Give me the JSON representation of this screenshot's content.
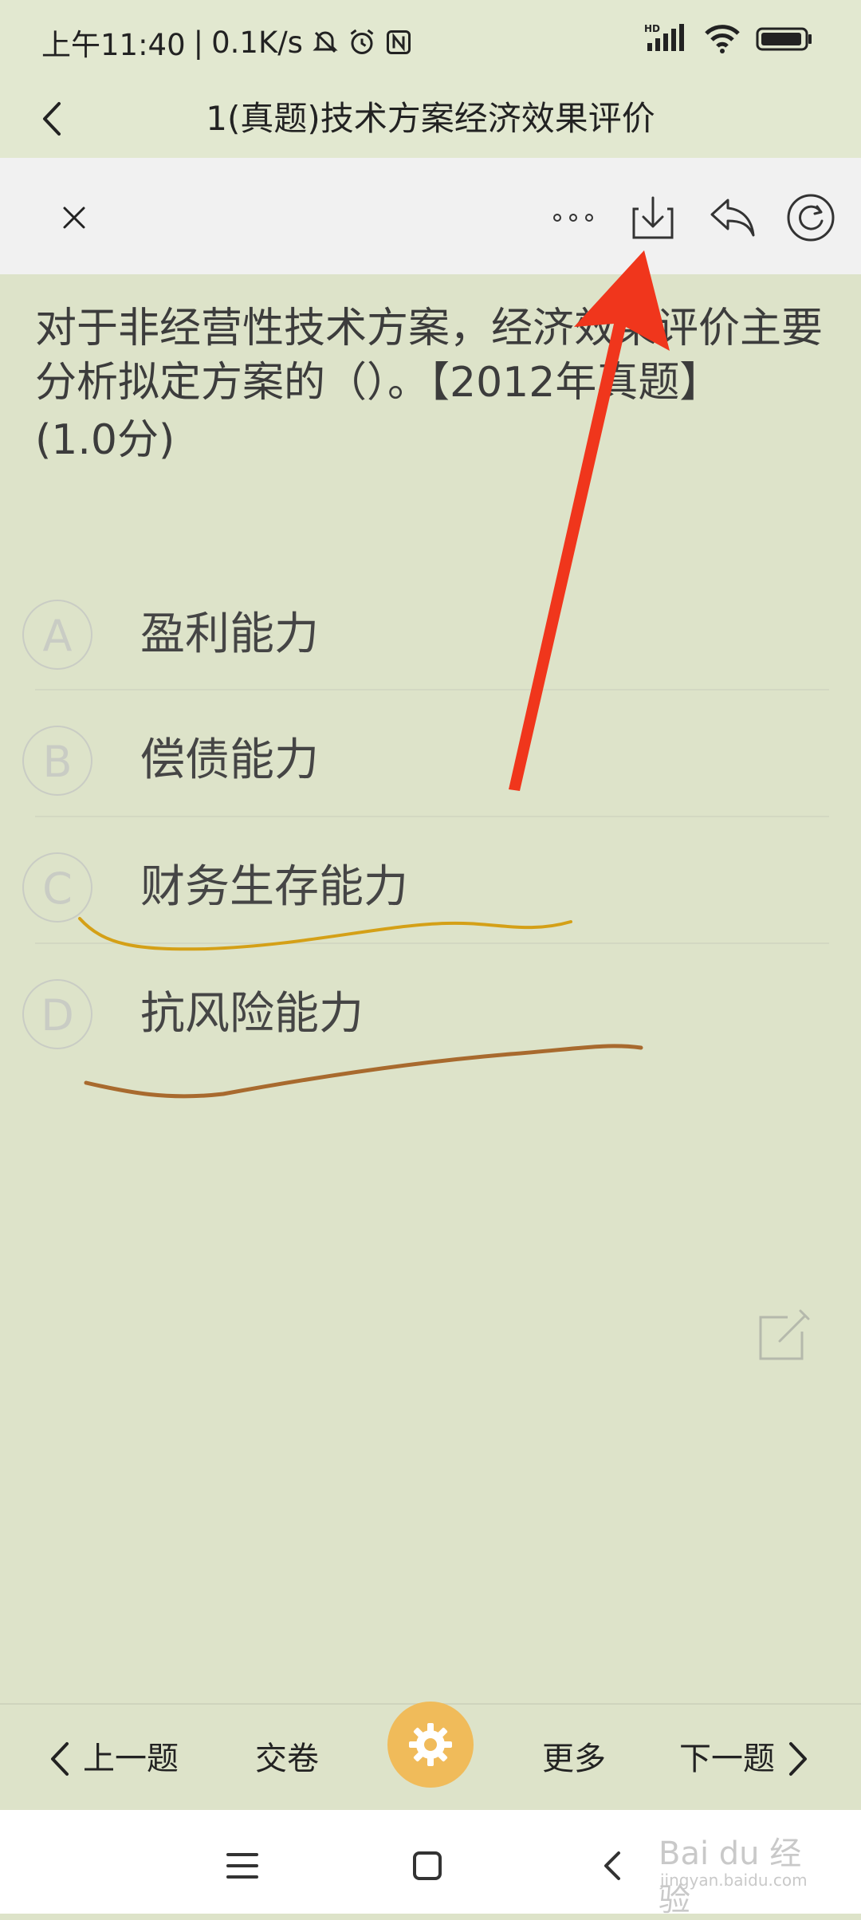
{
  "status_bar": {
    "time": "上午11:40",
    "network_speed": "0.1K/s",
    "icons": [
      "mute-bell-icon",
      "alarm-icon",
      "nfc-icon",
      "hd-signal-icon",
      "wifi-icon",
      "battery-icon"
    ],
    "hd_label": "HD"
  },
  "title_bar": {
    "title": "1(真题)技术方案经济效果评价"
  },
  "toolbar": {
    "icons": [
      "close-icon",
      "more-icon",
      "download-icon",
      "share-icon",
      "refresh-icon"
    ]
  },
  "question": {
    "text": "对于非经营性技术方案，经济效果评价主要分析拟定方案的（）。【2012年真题】",
    "score": "(1.0分)"
  },
  "options": [
    {
      "letter": "A",
      "text": "盈利能力"
    },
    {
      "letter": "B",
      "text": "偿债能力"
    },
    {
      "letter": "C",
      "text": "财务生存能力"
    },
    {
      "letter": "D",
      "text": "抗风险能力"
    }
  ],
  "bottom_bar": {
    "prev_label": "上一题",
    "submit_label": "交卷",
    "more_label": "更多",
    "next_label": "下一题"
  },
  "watermark": {
    "text": "Bai du 经验",
    "sub": "jingyan.baidu.com"
  },
  "colors": {
    "background": "#dde3c9",
    "toolbar": "#f1f1f1",
    "gear_button": "#f0bb5a",
    "annotation_arrow": "#f0361c",
    "underline_c": "#d4a017",
    "underline_d": "#a86a2e"
  }
}
